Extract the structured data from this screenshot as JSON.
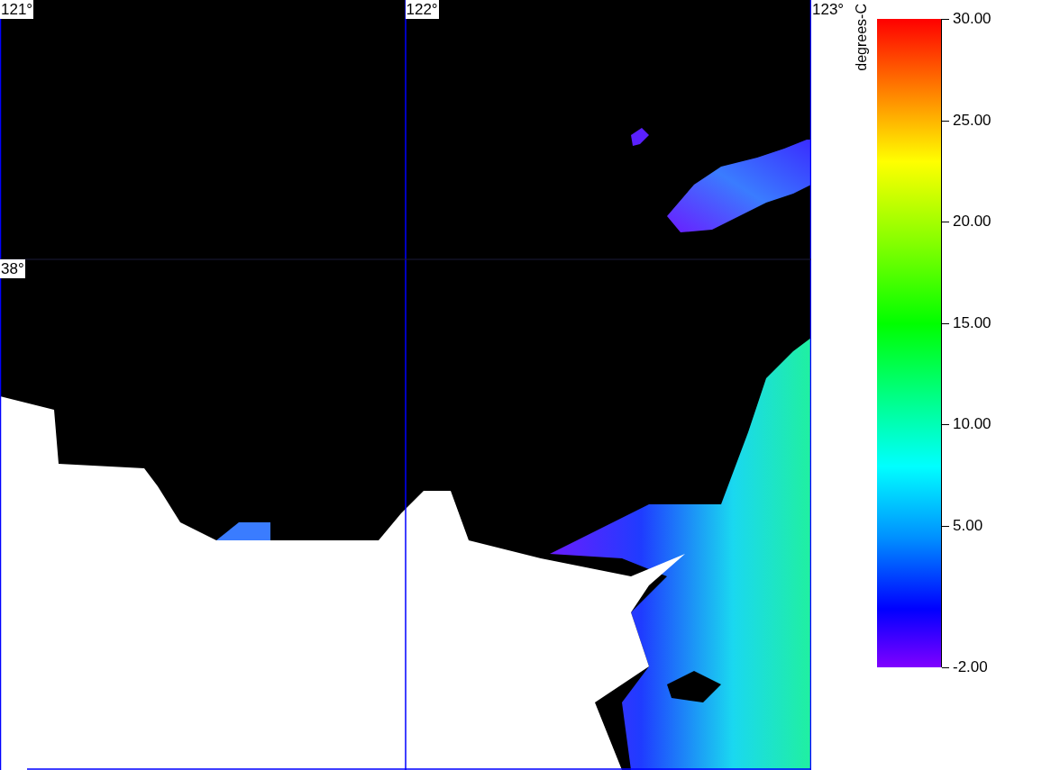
{
  "map": {
    "lon_labels": [
      "121°",
      "122°",
      "123°"
    ],
    "lat_labels": [
      "38°"
    ]
  },
  "colorbar": {
    "title": "degrees-C",
    "ticks": [
      "30.00",
      "25.00",
      "20.00",
      "15.00",
      "10.00",
      "5.00",
      "-2.00"
    ]
  }
}
